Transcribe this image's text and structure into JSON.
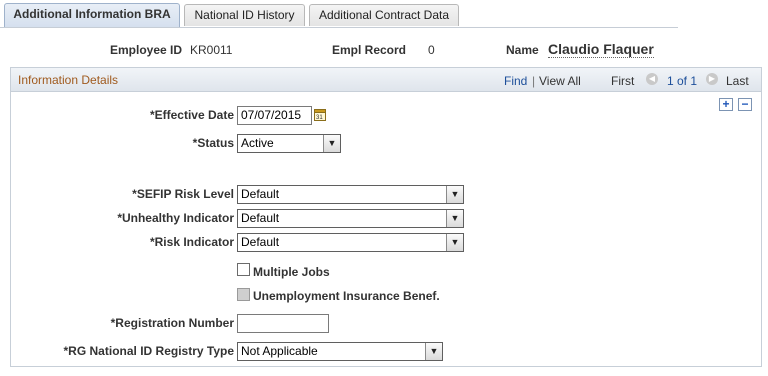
{
  "tabs": [
    {
      "label": "Additional Information BRA",
      "active": true
    },
    {
      "label": "National ID History",
      "active": false
    },
    {
      "label": "Additional Contract Data",
      "active": false
    }
  ],
  "header": {
    "employee_id_label": "Employee ID",
    "employee_id_value": "KR0011",
    "empl_record_label": "Empl Record",
    "empl_record_value": "0",
    "name_label": "Name",
    "name_value": "Claudio Flaquer"
  },
  "grid": {
    "title": "Information Details",
    "find": "Find",
    "sep": "|",
    "view_all": "View All",
    "first": "First",
    "page_info": "1 of 1",
    "last": "Last"
  },
  "form": {
    "effective_date_label": "*Effective Date",
    "effective_date_value": "07/07/2015",
    "status_label": "*Status",
    "status_value": "Active",
    "sefip_label": "*SEFIP Risk Level",
    "sefip_value": "Default",
    "unhealthy_label": "*Unhealthy Indicator",
    "unhealthy_value": "Default",
    "risk_label": "*Risk Indicator",
    "risk_value": "Default",
    "multiple_jobs_label": "Multiple Jobs",
    "multiple_jobs_checked": false,
    "unemployment_label": "Unemployment Insurance Benef.",
    "unemployment_checked": false,
    "registration_label": "*Registration Number",
    "registration_value": "",
    "rg_label": "*RG National ID Registry Type",
    "rg_value": "Not Applicable"
  },
  "icons": {
    "calendar": "calendar-icon",
    "add_row": "plus-icon",
    "delete_row": "minus-icon",
    "prev": "previous-icon",
    "next": "next-icon",
    "dropdown": "chevron-down-icon"
  },
  "colors": {
    "link": "#1d4f9a",
    "grid_title": "#a05a1e",
    "tab_active": "#d4dfee"
  }
}
